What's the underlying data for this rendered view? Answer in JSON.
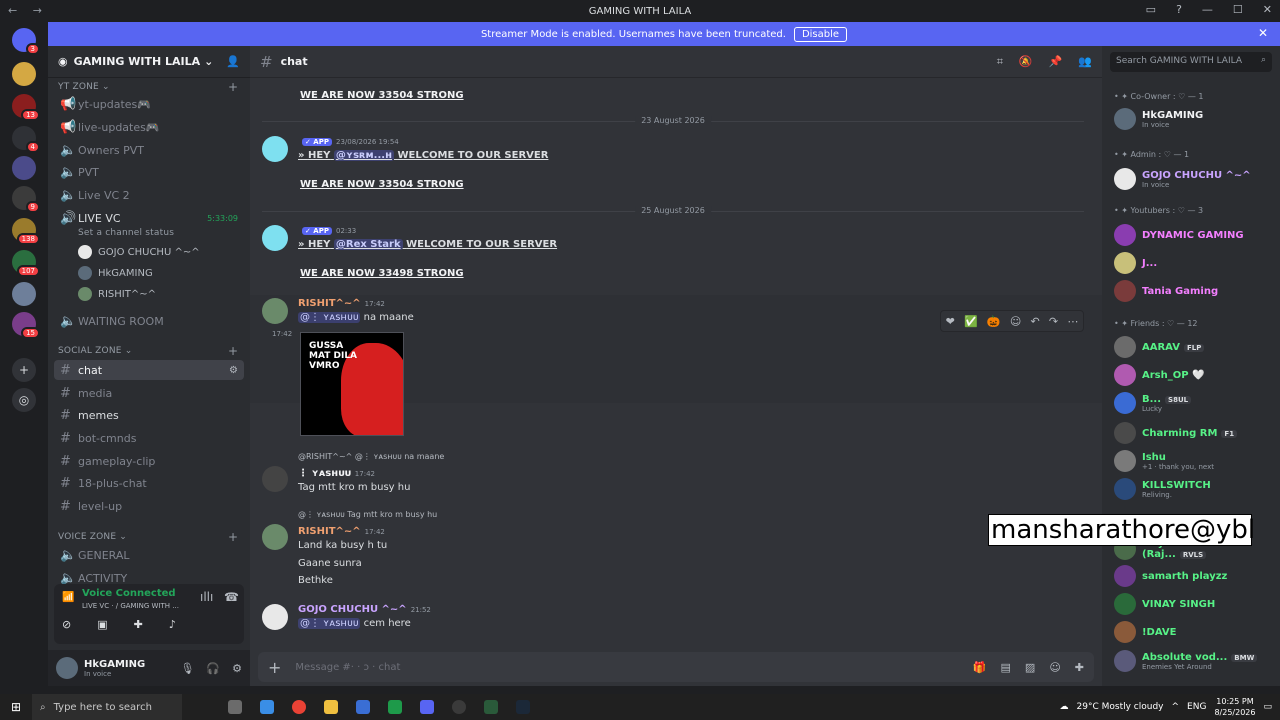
{
  "window": {
    "title": "GAMING WITH LAILA",
    "nav": "← →"
  },
  "banner": {
    "text": "Streamer Mode is enabled. Usernames have been truncated.",
    "button": "Disable"
  },
  "servers": [
    {
      "color": "#5865f2",
      "badge": "3"
    },
    {
      "color": "#d4a843",
      "badge": ""
    },
    {
      "color": "#8b1e1e",
      "badge": "13"
    },
    {
      "color": "#2f3136",
      "badge": "4"
    },
    {
      "color": "#4b4b8a",
      "badge": ""
    },
    {
      "color": "#3b3b3b",
      "badge": "9"
    },
    {
      "color": "#9a7b2c",
      "badge": "138"
    },
    {
      "color": "#2a6e3f",
      "badge": "107"
    },
    {
      "color": "#6e7f9a",
      "badge": ""
    },
    {
      "color": "#7a3d8a",
      "badge": "15"
    }
  ],
  "guild": {
    "name": "GAMING WITH LAILA"
  },
  "sidebar": {
    "cat_yt": "YT ZONE",
    "cat_social": "SOCIAL ZONE",
    "cat_voice": "VOICE ZONE",
    "yt_channels": [
      "yt-updates🎮",
      "live-updates🎮",
      "Owners PVT",
      "PVT",
      "Live VC 2",
      "LIVE VC"
    ],
    "live_time": "5:33:09",
    "channel_status": "Set a channel status",
    "voice_users": [
      "GOJO CHUCHU ^~^",
      "HkGAMING",
      "RISHIT^~^"
    ],
    "waiting_room": "WAITING ROOM",
    "social_channels": [
      "chat",
      "media",
      "memes",
      "bot-cmnds",
      "gameplay-clip",
      "18-plus-chat",
      "level-up"
    ],
    "voice_channels": [
      "GENERAL",
      "ACTIVITY"
    ]
  },
  "voice": {
    "status": "Voice Connected",
    "where": "LIVE VC · / GAMING WITH ..."
  },
  "user": {
    "name": "HkGAMING",
    "status": "In voice"
  },
  "chat": {
    "channel": "chat",
    "composer_placeholder": "Message #· · ɔ · chat",
    "strong1": "WE ARE NOW 33504 STRONG",
    "date1": "23 August 2026",
    "app_label": "✓ APP",
    "ts_app1": "23/08/2026 19:54",
    "hey_text": "HEY",
    "welcome_text": "WELCOME TO OUR SERVER",
    "mention1": "@ʏꜱʀᴍ...ʜ",
    "strong2": "WE ARE NOW 33504 STRONG",
    "date2": "25 August 2026",
    "ts_app2": "02:33",
    "mention2": "@Rex Stark",
    "strong3": "WE ARE NOW 33498 STRONG",
    "rishit": "RISHIT^~^",
    "ts_r1": "17:42",
    "line_r1_mention": "@⋮ ʏᴀꜱʜᴜᴜ",
    "line_r1": "na maane",
    "img_ts": "17:42",
    "meme_text": "GUSSA\nMAT DILA\nVMRO",
    "reply1": "@RISHIT^~^ @⋮ ʏᴀꜱʜᴜᴜ na maane",
    "yashuu": "⋮ ʏᴀꜱʜᴜᴜ",
    "ts_y": "17:42",
    "line_y": "Tag mtt kro m busy hu",
    "reply2": "@⋮ ʏᴀꜱʜᴜᴜ Tag mtt kro m busy hu",
    "ts_r2": "17:42",
    "r2_lines": [
      "Land ka busy h tu",
      "Gaane sunra",
      "Bethke"
    ],
    "gojo": "GOJO CHUCHU ^~^",
    "ts_g": "21:52",
    "line_g_mention": "@⋮ ʏᴀꜱʜᴜᴜ",
    "line_g": "cem here"
  },
  "members": {
    "search_placeholder": "Search GAMING WITH LAILA",
    "groups": [
      {
        "label": "Co-Owner : ♡ — 1"
      },
      {
        "label": "Admin : ♡ — 1"
      },
      {
        "label": "Youtubers : ♡ — 3"
      },
      {
        "label": "Friends : ♡ — 12"
      }
    ],
    "list": [
      {
        "name": "HkGAMING",
        "sub": "In voice",
        "color": "#f2f3f5",
        "av": "#5b6b7a"
      },
      {
        "name": "GOJO CHUCHU ^~^",
        "sub": "In voice",
        "color": "#c9a4ff",
        "av": "#e8e8e8"
      },
      {
        "name": "DYNAMIC GAMING",
        "sub": "",
        "color": "#f47fff",
        "av": "#8a3db0"
      },
      {
        "name": "J...",
        "sub": "",
        "color": "#f47fff",
        "av": "#c8c07a"
      },
      {
        "name": "Tania Gaming",
        "sub": "",
        "color": "#f47fff",
        "av": "#7a3b3b"
      },
      {
        "name": "AARAV",
        "sub": "",
        "color": "#57f287",
        "av": "#6b6b6b",
        "tag": "FLP"
      },
      {
        "name": "Arsh_OP 🤍",
        "sub": "",
        "color": "#57f287",
        "av": "#b05ab0"
      },
      {
        "name": "B...",
        "sub": "Lucky",
        "color": "#57f287",
        "av": "#3a6bd4",
        "tag": "S8UL"
      },
      {
        "name": "Charming RM",
        "sub": "",
        "color": "#57f287",
        "av": "#4a4a4a",
        "tag": "F1"
      },
      {
        "name": "Ishu",
        "sub": "+1 · thank you, next",
        "color": "#57f287",
        "av": "#7a7a7a"
      },
      {
        "name": "KILLSWITCH",
        "sub": "Reliving.",
        "color": "#57f287",
        "av": "#2a4a7a"
      },
      {
        "name": "Priydarshan (Raj...",
        "sub": "",
        "color": "#57f287",
        "av": "#4a6b4a",
        "tag": "RVLS"
      },
      {
        "name": "samarth playzz",
        "sub": "",
        "color": "#57f287",
        "av": "#6a3a8a"
      },
      {
        "name": "VINAY SINGH",
        "sub": "",
        "color": "#57f287",
        "av": "#2a6a3a"
      },
      {
        "name": "!DAVE",
        "sub": "",
        "color": "#57f287",
        "av": "#8a5a3a"
      },
      {
        "name": "Absolute vod...",
        "sub": "Enemies Yet Around",
        "color": "#57f287",
        "av": "#5a5a7a",
        "tag": "BMW"
      }
    ]
  },
  "overlay": {
    "text": "mansharathore@ybl"
  },
  "taskbar": {
    "search": "Type here to search",
    "weather": "29°C  Mostly cloudy",
    "lang": "ENG",
    "time": "10:25 PM",
    "date": "8/25/2026"
  }
}
